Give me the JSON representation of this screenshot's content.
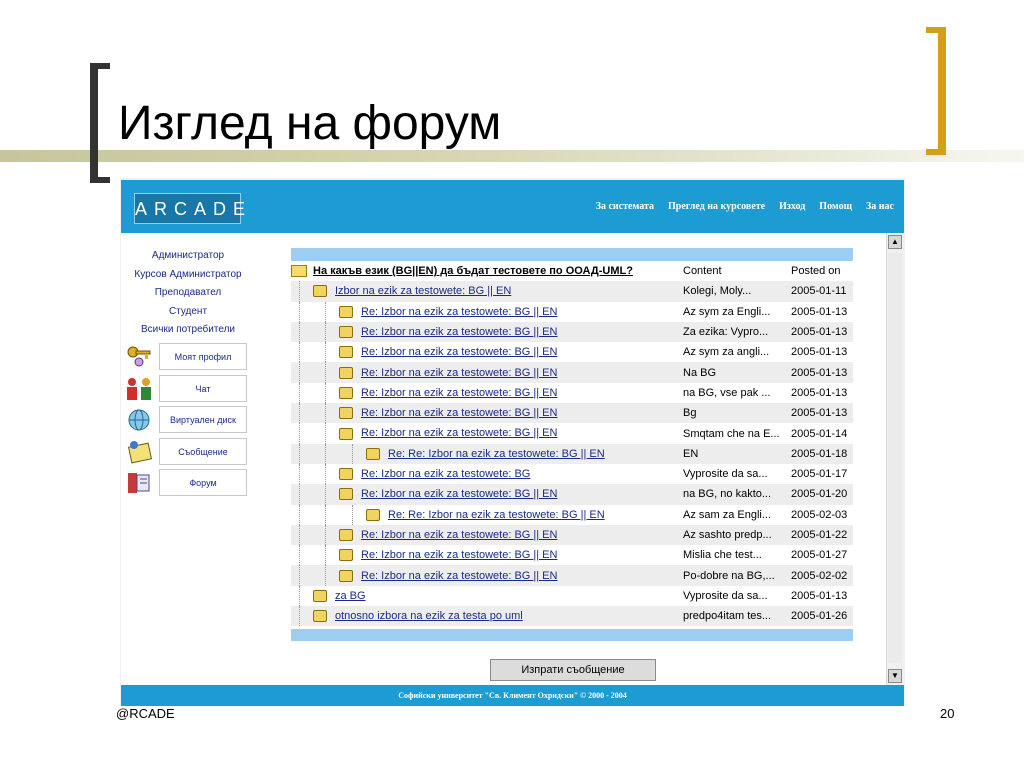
{
  "slide": {
    "title": "Изглед на форум",
    "footer_left": "@RCADE",
    "page_number": "20"
  },
  "app": {
    "logo": "ARCADE",
    "top_nav": [
      "За системата",
      "Преглед на курсовете",
      "Изход",
      "Помощ",
      "За нас"
    ],
    "footer": "Софийски университет \"Св. Климент Охридски\" © 2000 - 2004"
  },
  "sidebar": {
    "roles": [
      "Администратор",
      "Курсов Администратор",
      "Преподавател",
      "Студент",
      "Всички потребители"
    ],
    "buttons": [
      {
        "label": "Моят профил",
        "icon": "keys-icon"
      },
      {
        "label": "Чат",
        "icon": "people-icon"
      },
      {
        "label": "Виртуален диск",
        "icon": "globe-disk-icon"
      },
      {
        "label": "Съобщение",
        "icon": "message-icon"
      },
      {
        "label": "Форум",
        "icon": "forum-icon"
      }
    ]
  },
  "forum": {
    "thread_title": "На какъв език (BG||EN) да бъдат тестовете по ООАД-UML?",
    "col_content": "Content",
    "col_posted": "Posted on",
    "messages": [
      {
        "topic": "Izbor na ezik za testowete: BG || EN",
        "preview": "Kolegi, Moly...",
        "date": "2005-01-11",
        "level": 1
      },
      {
        "topic": "Re: Izbor na ezik za testowete: BG || EN",
        "preview": "Az sym za Engli...",
        "date": "2005-01-13",
        "level": 2
      },
      {
        "topic": "Re: Izbor na ezik za testowete: BG || EN",
        "preview": "Za ezika: Vypro...",
        "date": "2005-01-13",
        "level": 2
      },
      {
        "topic": "Re: Izbor na ezik za testowete: BG || EN",
        "preview": "Az sym za angli...",
        "date": "2005-01-13",
        "level": 2
      },
      {
        "topic": "Re: Izbor na ezik za testowete: BG || EN",
        "preview": "Na BG",
        "date": "2005-01-13",
        "level": 2
      },
      {
        "topic": "Re: Izbor na ezik za testowete: BG || EN",
        "preview": "na BG, vse pak ...",
        "date": "2005-01-13",
        "level": 2
      },
      {
        "topic": "Re: Izbor na ezik za testowete: BG || EN",
        "preview": "Bg",
        "date": "2005-01-13",
        "level": 2
      },
      {
        "topic": "Re: Izbor na ezik za testowete: BG || EN",
        "preview": "Smqtam che na E...",
        "date": "2005-01-14",
        "level": 2
      },
      {
        "topic": "Re: Re: Izbor na ezik za testowete: BG || EN",
        "preview": "EN",
        "date": "2005-01-18",
        "level": 3
      },
      {
        "topic": "Re: Izbor na ezik za testowete: BG",
        "preview": "Vyprosite da sa...",
        "date": "2005-01-17",
        "level": 2
      },
      {
        "topic": "Re: Izbor na ezik za testowete: BG || EN",
        "preview": "na BG, no kakto...",
        "date": "2005-01-20",
        "level": 2
      },
      {
        "topic": "Re: Re: Izbor na ezik za testowete: BG || EN",
        "preview": "Az sam za Engli...",
        "date": "2005-02-03",
        "level": 3
      },
      {
        "topic": "Re: Izbor na ezik za testowete: BG || EN",
        "preview": "Az sashto predp...",
        "date": "2005-01-22",
        "level": 2
      },
      {
        "topic": "Re: Izbor na ezik za testowete: BG || EN",
        "preview": "Mislia che test...",
        "date": "2005-01-27",
        "level": 2
      },
      {
        "topic": "Re: Izbor na ezik za testowete: BG || EN",
        "preview": "Po-dobre na BG,...",
        "date": "2005-02-02",
        "level": 2
      },
      {
        "topic": "za BG",
        "preview": "Vyprosite da sa...",
        "date": "2005-01-13",
        "level": 1
      },
      {
        "topic": "otnosno izbora na ezik za testa po uml",
        "preview": "predpo4itam tes...",
        "date": "2005-01-26",
        "level": 1
      }
    ],
    "send_button": "Изпрати съобщение"
  }
}
